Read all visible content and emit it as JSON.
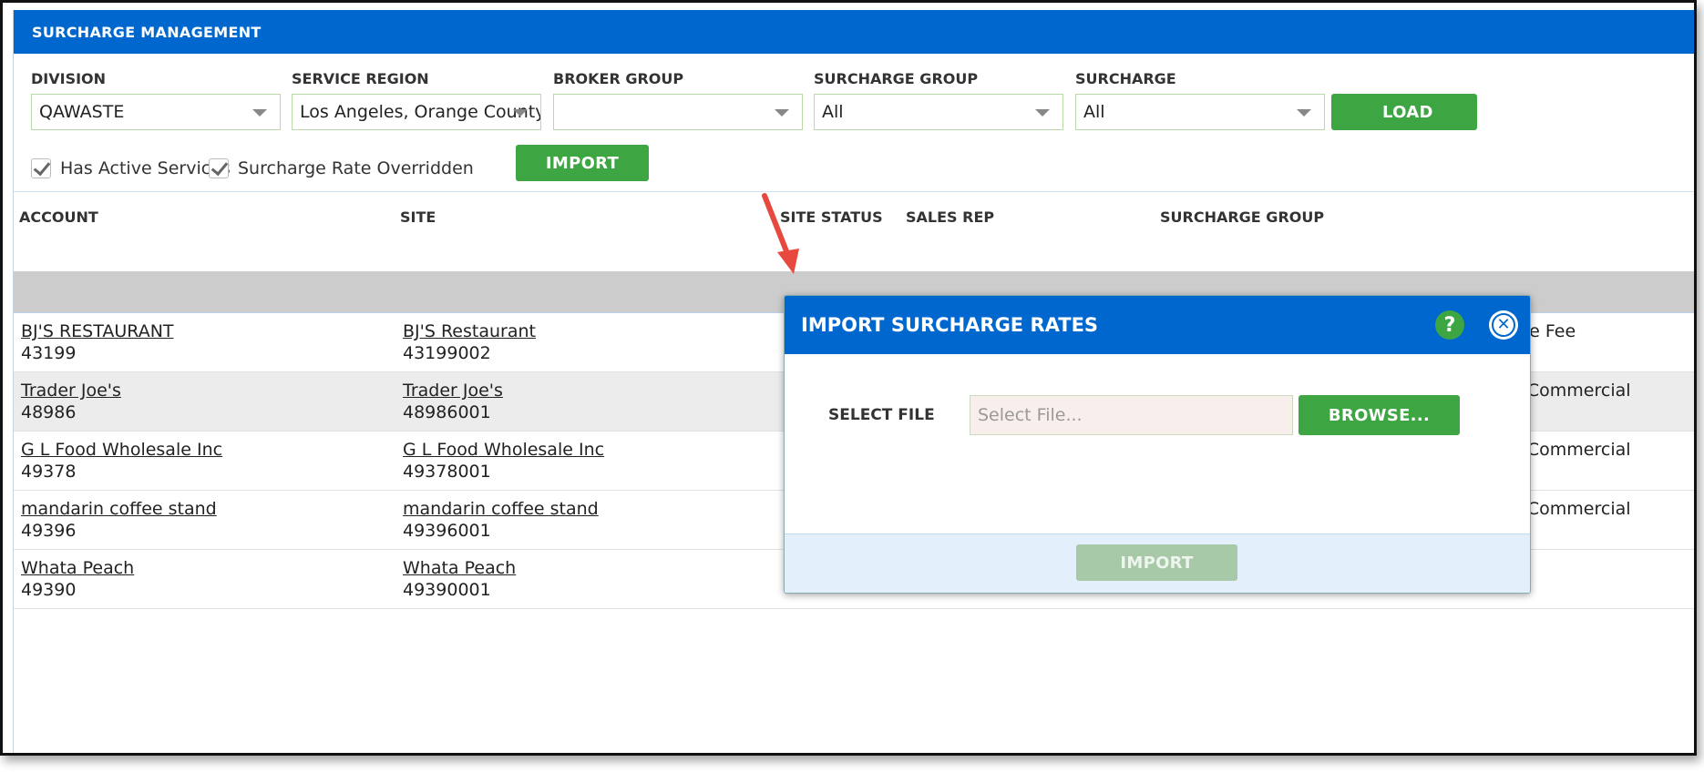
{
  "app": {
    "title": "SURCHARGE MANAGEMENT"
  },
  "filters": {
    "division": {
      "label": "DIVISION",
      "value": "QAWASTE"
    },
    "service_region": {
      "label": "SERVICE REGION",
      "value": "Los Angeles, Orange County,"
    },
    "broker_group": {
      "label": "BROKER GROUP",
      "value": ""
    },
    "surcharge_group": {
      "label": "SURCHARGE GROUP",
      "value": "All"
    },
    "surcharge": {
      "label": "SURCHARGE",
      "value": "All"
    },
    "load_button": "LOAD"
  },
  "options": {
    "has_active_services": {
      "label": "Has Active Services",
      "checked": true
    },
    "surcharge_rate_overridden": {
      "label": "Surcharge Rate Overridden",
      "checked": true
    }
  },
  "import_button": "IMPORT",
  "grid": {
    "columns": [
      "ACCOUNT",
      "SITE",
      "SITE STATUS",
      "SALES REP",
      "SURCHARGE GROUP"
    ],
    "rows": [
      {
        "account_name": "BJ'S RESTAURANT",
        "account_id": "43199",
        "site_name": "BJ'S Restaurant",
        "site_id": "43199002",
        "surcharge_group": "ise Fee"
      },
      {
        "account_name": "Trader Joe's",
        "account_id": "48986",
        "site_name": "Trader Joe's",
        "site_id": "48986001",
        "surcharge_group": "- Commercial"
      },
      {
        "account_name": "G L Food Wholesale Inc",
        "account_id": "49378",
        "site_name": "G L Food Wholesale Inc",
        "site_id": "49378001",
        "surcharge_group": "- Commercial"
      },
      {
        "account_name": "mandarin coffee stand",
        "account_id": "49396",
        "site_name": "mandarin coffee stand",
        "site_id": "49396001",
        "surcharge_group": "- Commercial"
      },
      {
        "account_name": "Whata Peach",
        "account_id": "49390",
        "site_name": "Whata Peach",
        "site_id": "49390001",
        "surcharge_group": ""
      }
    ]
  },
  "modal": {
    "title": "IMPORT SURCHARGE RATES",
    "help_symbol": "?",
    "close_symbol": "✕",
    "select_file_label": "SELECT FILE",
    "file_placeholder": "Select File...",
    "browse_button": "BROWSE...",
    "import_button": "IMPORT",
    "import_enabled": false
  },
  "colors": {
    "header_blue": "#0067ce",
    "button_green": "#3ea543",
    "disabled_green": "#a8c9a8",
    "arrow_red": "#e8493e"
  }
}
